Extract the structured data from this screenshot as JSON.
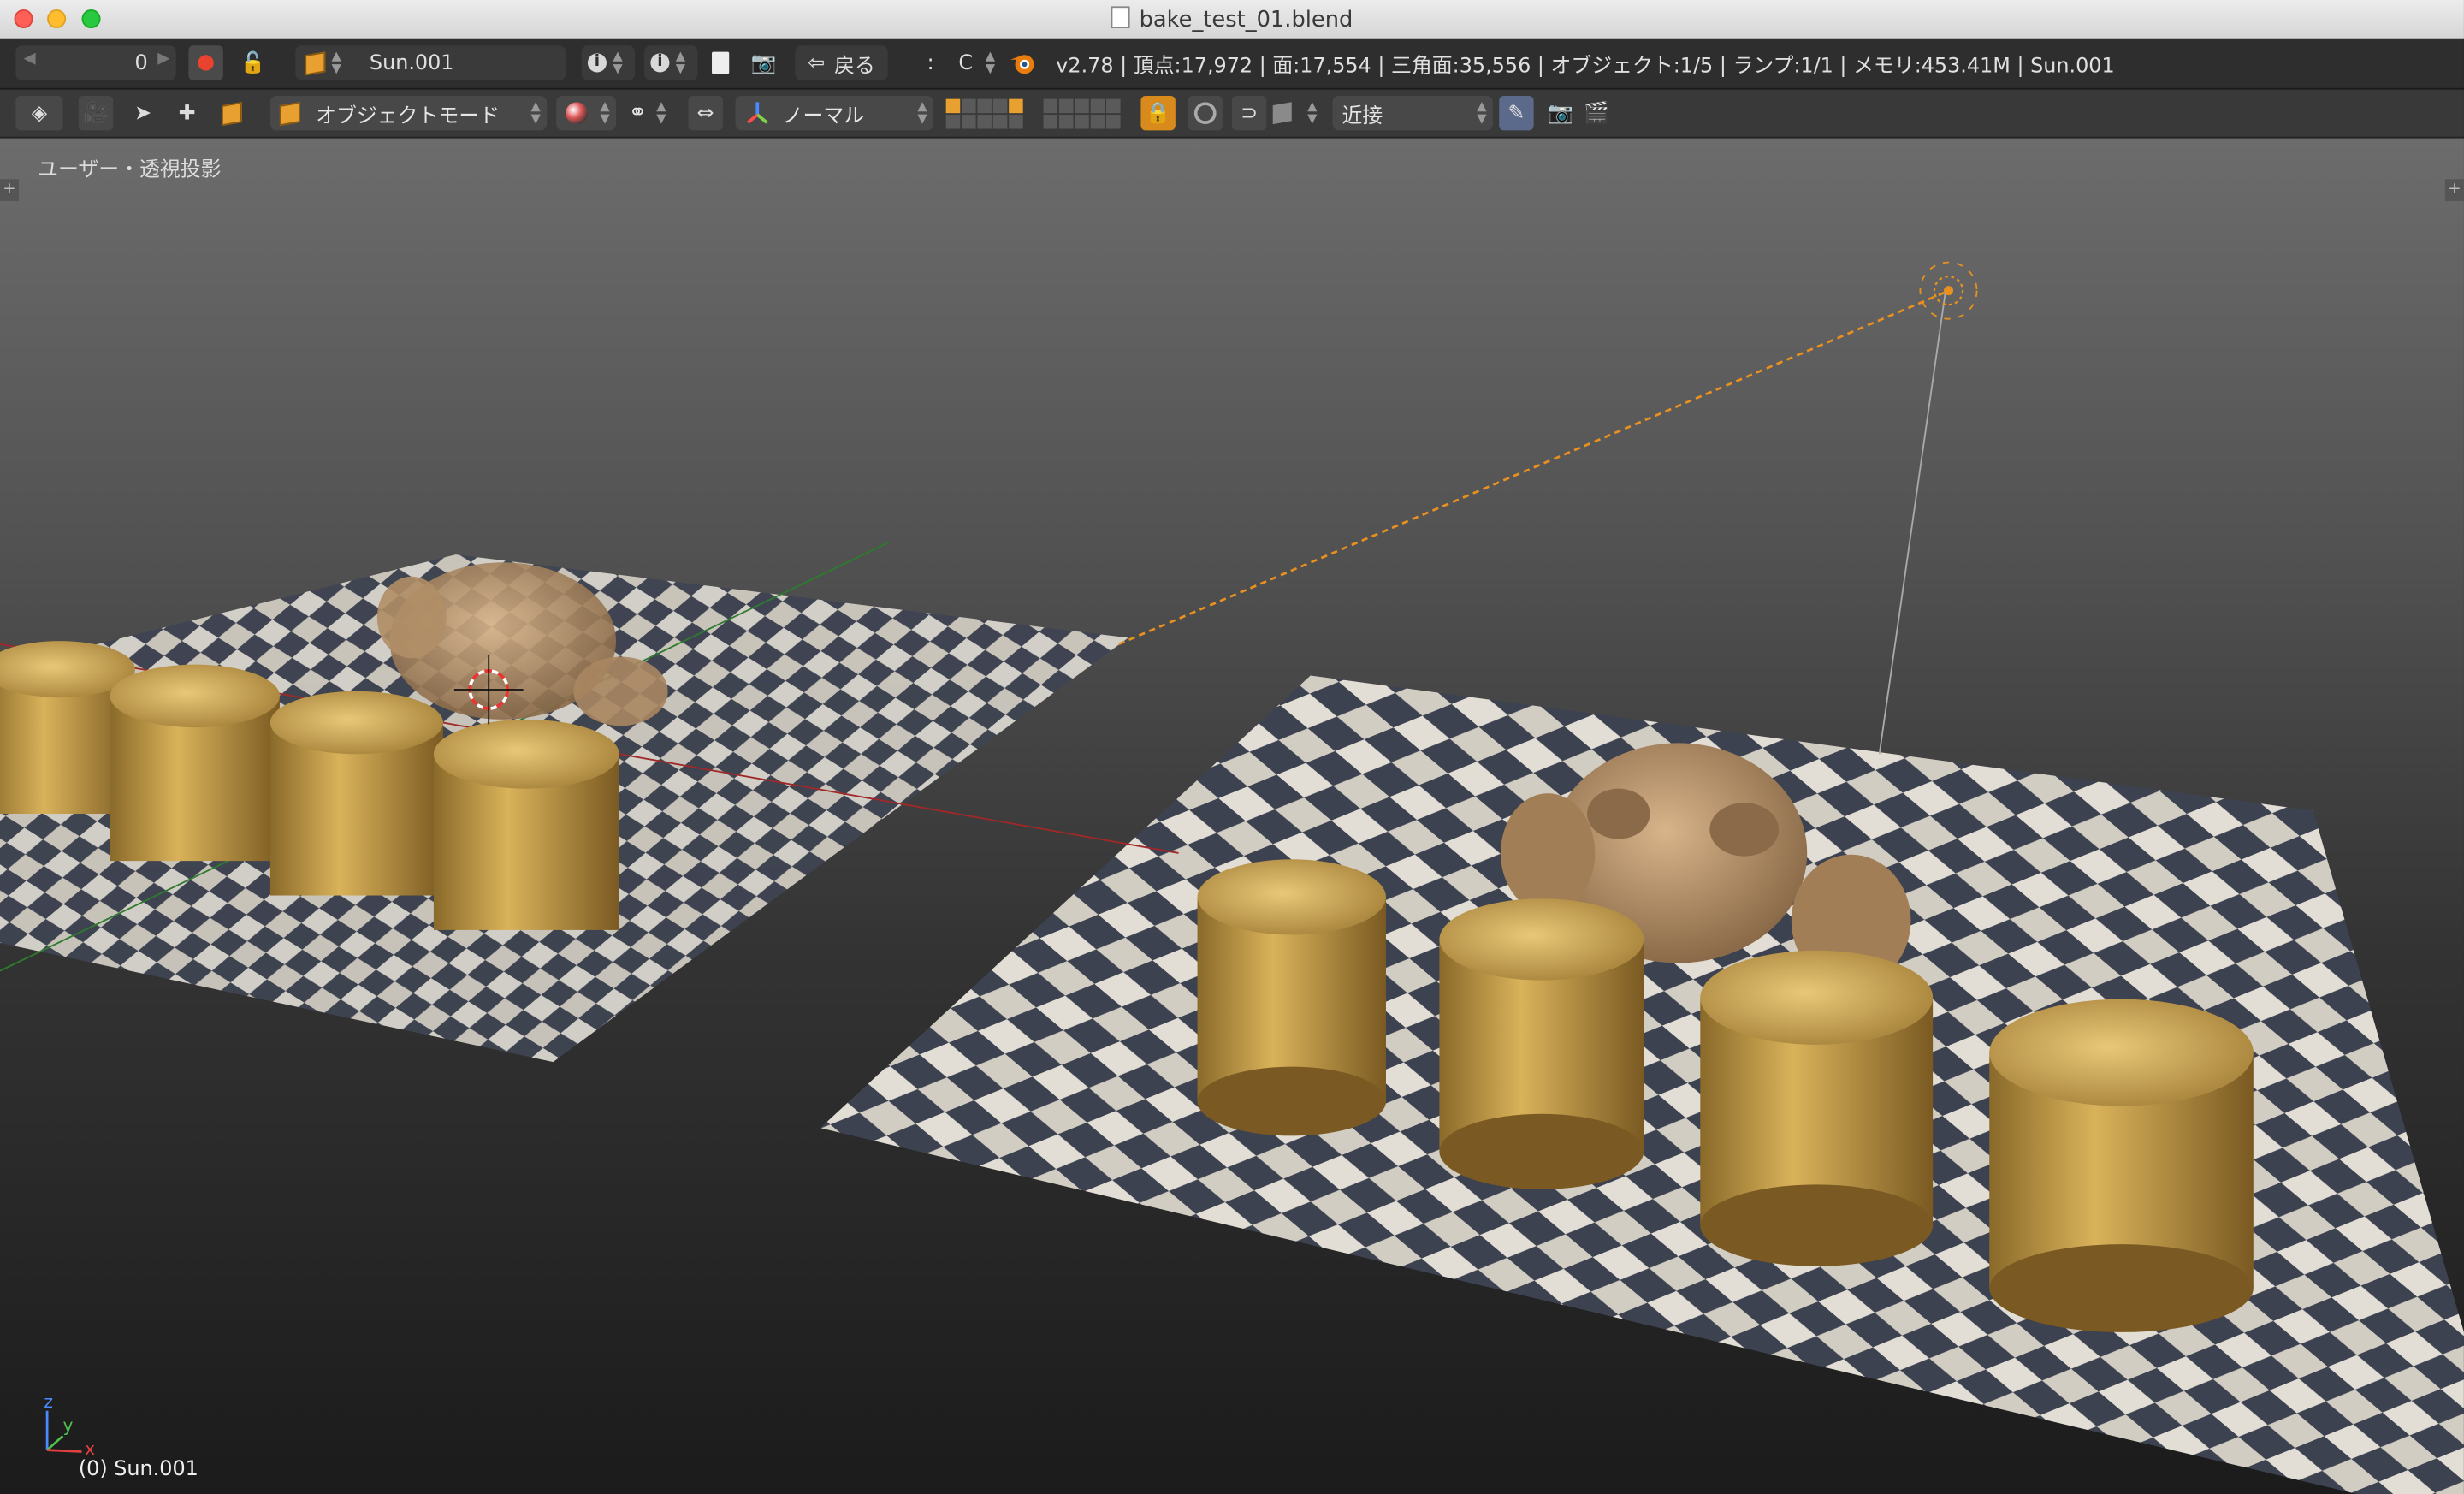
{
  "window": {
    "title": "bake_test_01.blend"
  },
  "info_header": {
    "frame_value": "0",
    "scene_name": "Sun.001",
    "undo_label": "戻る",
    "separator": ":",
    "render_engine_short": "C",
    "stats": "v2.78 | 頂点:17,972 | 面:17,554 | 三角面:35,556 | オブジェクト:1/5 | ランプ:1/1 | メモリ:453.41M | Sun.001"
  },
  "view_header": {
    "mode": "オブジェクトモード",
    "orientation": "ノーマル",
    "snap_target": "近接"
  },
  "viewport": {
    "view_label": "ユーザー・透視投影",
    "active_object": "(0) Sun.001",
    "axis_labels": {
      "x": "x",
      "y": "y",
      "z": "z"
    }
  },
  "colors": {
    "accent": "#e8a030",
    "record": "#e8432e",
    "viewport_top": "#6c6c6c",
    "viewport_bottom": "#1b1b1b"
  }
}
